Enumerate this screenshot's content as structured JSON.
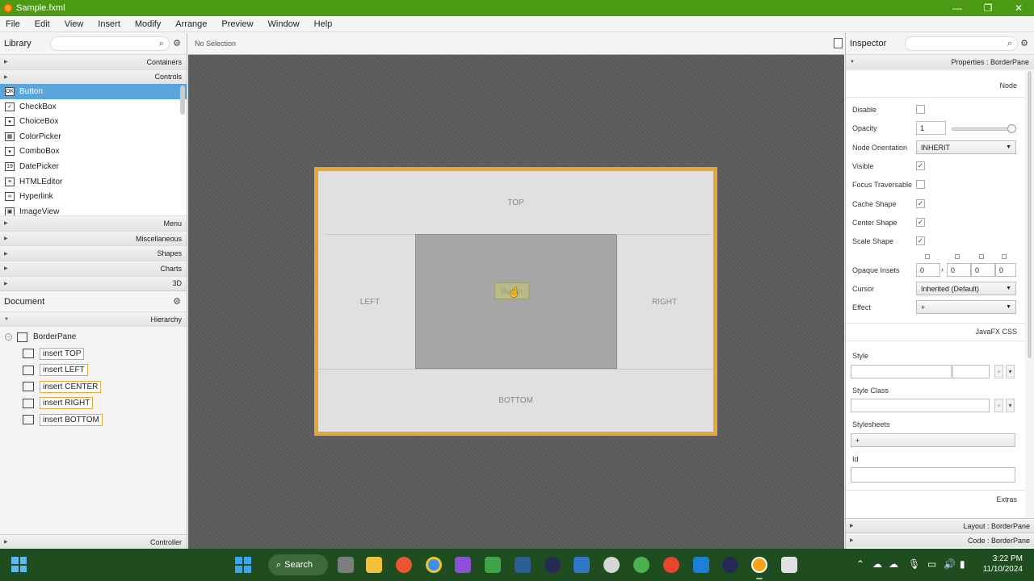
{
  "window": {
    "title": "Sample.fxml",
    "minimize": "—",
    "maximize": "❐",
    "close": "✕"
  },
  "menu": [
    "File",
    "Edit",
    "View",
    "Insert",
    "Modify",
    "Arrange",
    "Preview",
    "Window",
    "Help"
  ],
  "library": {
    "title": "Library",
    "sections_top": [
      "Containers",
      "Controls"
    ],
    "items": [
      {
        "label": "Button",
        "icon": "button-icon",
        "glyph": "OK",
        "selected": true
      },
      {
        "label": "CheckBox",
        "icon": "checkbox-icon",
        "glyph": "✓"
      },
      {
        "label": "ChoiceBox",
        "icon": "choicebox-icon",
        "glyph": "▾"
      },
      {
        "label": "ColorPicker",
        "icon": "colorpicker-icon",
        "glyph": "▦"
      },
      {
        "label": "ComboBox",
        "icon": "combobox-icon",
        "glyph": "▾"
      },
      {
        "label": "DatePicker",
        "icon": "datepicker-icon",
        "glyph": "19"
      },
      {
        "label": "HTMLEditor",
        "icon": "htmleditor-icon",
        "glyph": "≡"
      },
      {
        "label": "Hyperlink",
        "icon": "hyperlink-icon",
        "glyph": "∞"
      },
      {
        "label": "ImageView",
        "icon": "imageview-icon",
        "glyph": "▣"
      }
    ],
    "sections_bottom": [
      "Menu",
      "Miscellaneous",
      "Shapes",
      "Charts",
      "3D"
    ]
  },
  "document": {
    "title": "Document",
    "hierarchy_label": "Hierarchy",
    "root": "BorderPane",
    "children": [
      "insert TOP",
      "insert LEFT",
      "insert CENTER",
      "insert RIGHT",
      "insert BOTTOM"
    ],
    "controller_label": "Controller"
  },
  "canvas": {
    "selection_text": "No Selection",
    "regions": {
      "top": "TOP",
      "left": "LEFT",
      "right": "RIGHT",
      "bottom": "BOTTOM"
    },
    "dragged_button": "Button"
  },
  "inspector": {
    "title": "Inspector",
    "properties_header": "Properties : BorderPane",
    "node_label": "Node",
    "disable_label": "Disable",
    "opacity_label": "Opacity",
    "opacity_value": "1",
    "node_orientation_label": "Node Orientation",
    "node_orientation_value": "INHERIT",
    "visible_label": "Visible",
    "focus_traversable_label": "Focus Traversable",
    "cache_shape_label": "Cache Shape",
    "center_shape_label": "Center Shape",
    "scale_shape_label": "Scale Shape",
    "opaque_insets_label": "Opaque Insets",
    "opaque_insets": [
      "0",
      "0",
      "0",
      "0"
    ],
    "cursor_label": "Cursor",
    "cursor_value": "Inherited (Default)",
    "effect_label": "Effect",
    "effect_value": "+",
    "javafx_css_label": "JavaFX CSS",
    "style_label": "Style",
    "style_class_label": "Style Class",
    "stylesheets_label": "Stylesheets",
    "stylesheets_add": "+",
    "id_label": "Id",
    "extras_label": "Extras",
    "layout_header": "Layout : BorderPane",
    "code_header": "Code : BorderPane"
  },
  "taskbar": {
    "search_label": "Search",
    "time": "3:22 PM",
    "date": "11/10/2024"
  }
}
